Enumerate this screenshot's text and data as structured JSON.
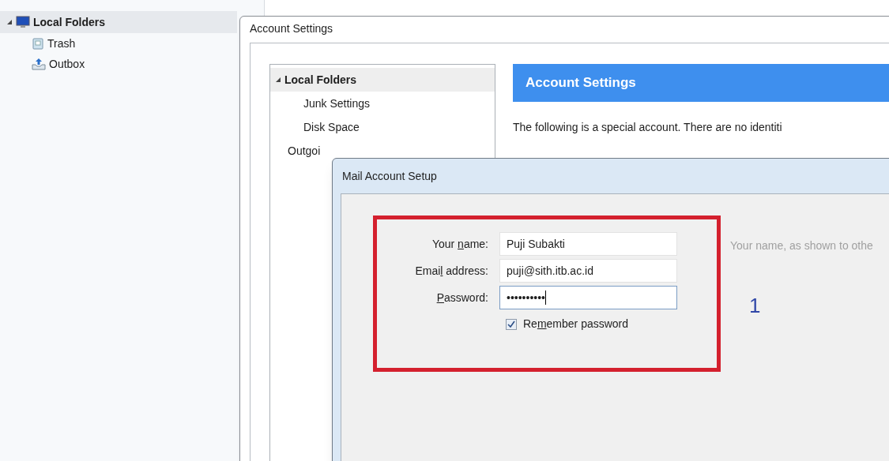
{
  "folder_pane": {
    "root": {
      "label": "Local Folders",
      "expanded": true,
      "selected": true,
      "children": [
        {
          "label": "Trash",
          "kind": "trash"
        },
        {
          "label": "Outbox",
          "kind": "outbox"
        }
      ]
    }
  },
  "account_settings_window": {
    "title": "Account Settings",
    "tree": [
      {
        "label": "Local Folders",
        "expanded": true,
        "selected": true,
        "children": [
          {
            "label": "Junk Settings"
          },
          {
            "label": "Disk Space"
          }
        ]
      },
      {
        "label": "Outgoi",
        "selected": false
      }
    ],
    "header": "Account Settings",
    "description": "The following is a special account. There are no identiti"
  },
  "mail_setup_dialog": {
    "title": "Mail Account Setup",
    "fields": [
      {
        "label": {
          "before": "Your ",
          "key": "n",
          "after": "ame:"
        },
        "value": "Puji Subakti",
        "focused": false
      },
      {
        "label": {
          "before": "Emai",
          "key": "l",
          "after": " address:"
        },
        "value": "puji@sith.itb.ac.id",
        "focused": false
      },
      {
        "label": {
          "key": "P",
          "after": "assword:"
        },
        "value": "••••••••••",
        "focused": true
      }
    ],
    "remember": {
      "label": {
        "before": "Re",
        "key": "m",
        "after": "ember password"
      },
      "checked": true
    },
    "hint": "Your name, as shown to othe",
    "step_number": "1"
  }
}
